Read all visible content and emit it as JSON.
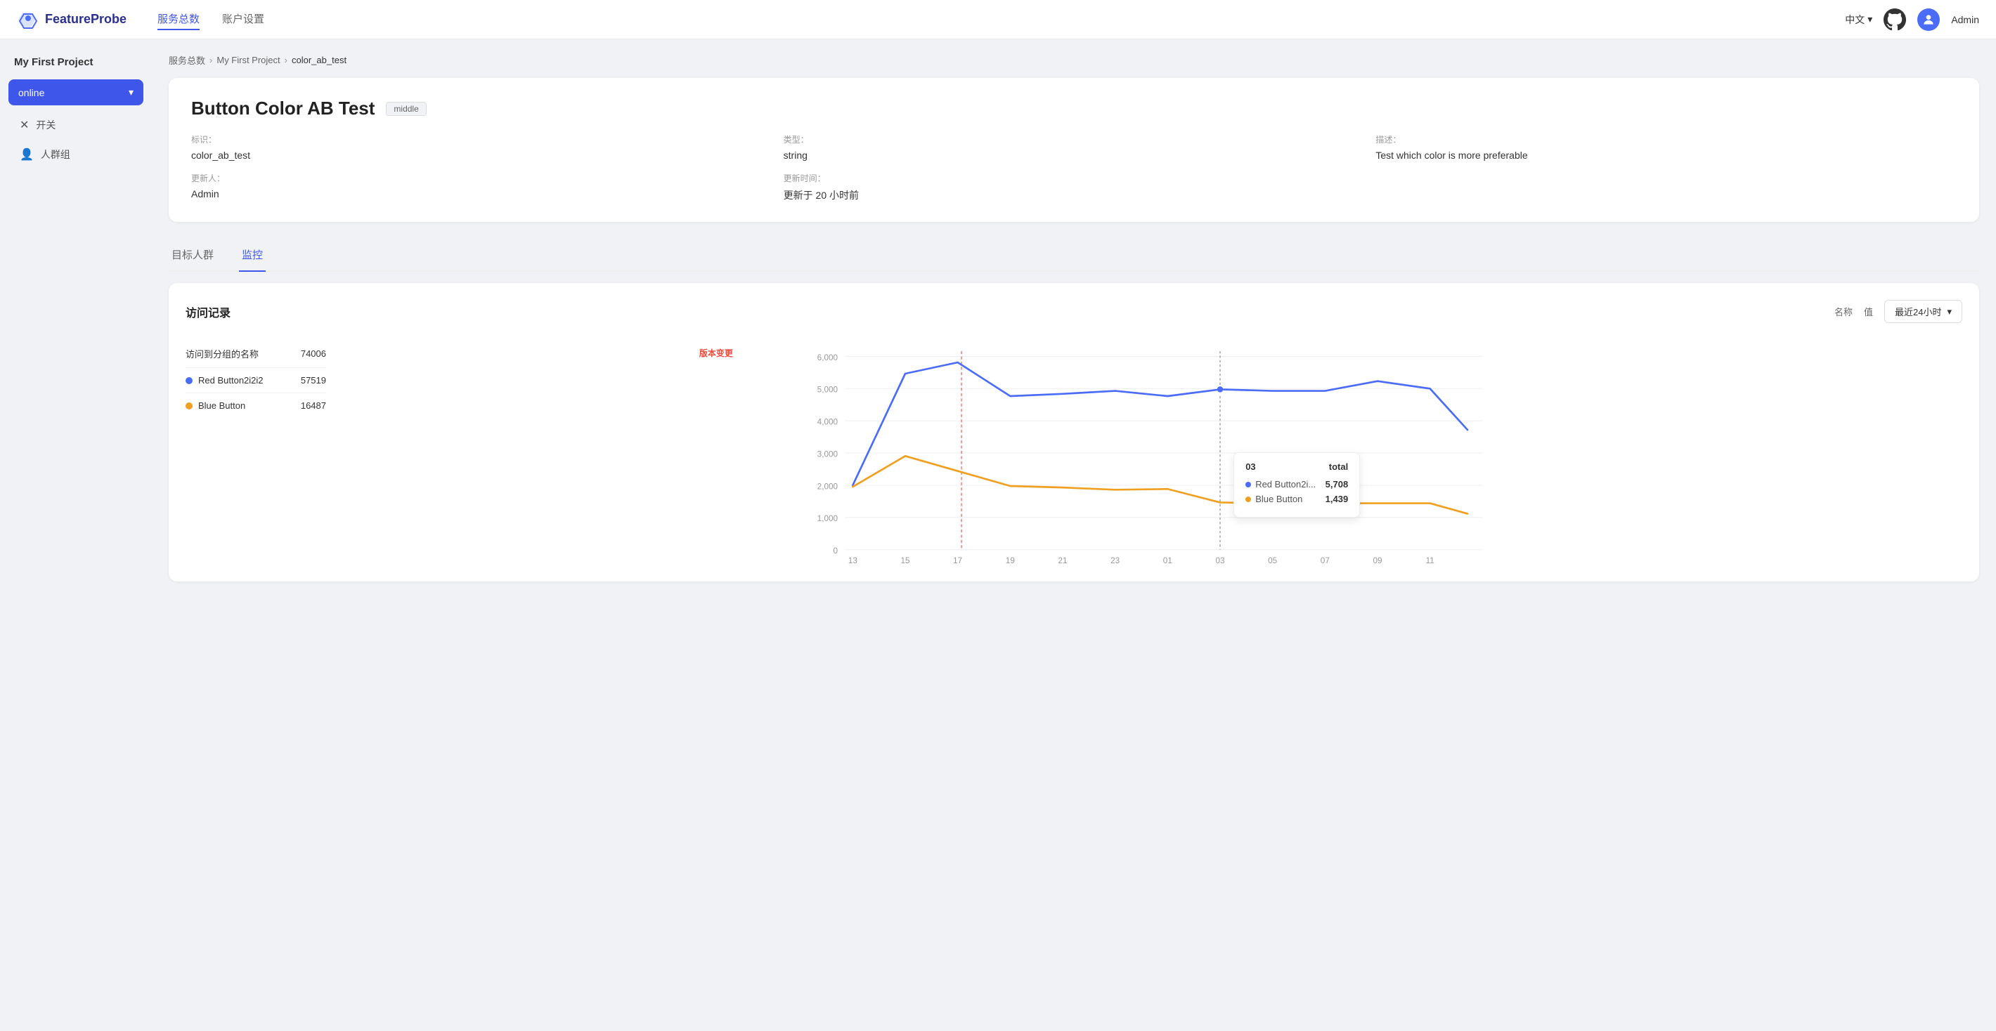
{
  "app": {
    "name": "FeatureProbe"
  },
  "topNav": {
    "links": [
      {
        "id": "services",
        "label": "服务总数",
        "active": true
      },
      {
        "id": "account",
        "label": "账户设置",
        "active": false
      }
    ],
    "language": "中文",
    "username": "Admin"
  },
  "sidebar": {
    "projectTitle": "My First Project",
    "env": {
      "label": "online",
      "chevron": "▾"
    },
    "menuItems": [
      {
        "id": "toggle",
        "icon": "✕",
        "label": "开关"
      },
      {
        "id": "segment",
        "icon": "👤",
        "label": "人群组"
      }
    ]
  },
  "breadcrumb": {
    "items": [
      {
        "label": "服务总数",
        "link": true
      },
      {
        "label": "My First Project",
        "link": true
      },
      {
        "label": "color_ab_test",
        "link": false
      }
    ]
  },
  "feature": {
    "title": "Button Color AB Test",
    "badge": "middle",
    "meta": [
      {
        "id": "key",
        "label": "标识：",
        "value": "color_ab_test"
      },
      {
        "id": "type",
        "label": "类型：",
        "value": "string"
      },
      {
        "id": "desc",
        "label": "描述：",
        "value": "Test which color is more preferable"
      },
      {
        "id": "updater",
        "label": "更新人：",
        "value": "Admin"
      },
      {
        "id": "updateTime",
        "label": "更新时间：",
        "value": "更新于 20 小时前"
      }
    ]
  },
  "tabs": [
    {
      "id": "audience",
      "label": "目标人群",
      "active": false
    },
    {
      "id": "monitor",
      "label": "监控",
      "active": true
    }
  ],
  "monitor": {
    "title": "访问记录",
    "controls": {
      "nameLabel": "名称",
      "valueLabel": "值",
      "timeRange": "最近24小时"
    },
    "legend": [
      {
        "id": "total",
        "label": "访问到分组的名称",
        "color": null,
        "value": "74006"
      },
      {
        "id": "red",
        "label": "Red Button2i2i2",
        "color": "#4a6cf7",
        "value": "57519"
      },
      {
        "id": "blue",
        "label": "Blue Button",
        "color": "#f0a020",
        "value": "16487"
      }
    ],
    "tooltip": {
      "header": "03",
      "headerRight": "total",
      "rows": [
        {
          "label": "Red Button2i...",
          "color": "#4a6cf7",
          "value": "5,708"
        },
        {
          "label": "Blue Button",
          "color": "#f0a020",
          "value": "1,439"
        }
      ]
    },
    "xAxisLabels": [
      "13",
      "15",
      "17",
      "19",
      "21",
      "23",
      "01",
      "03",
      "05",
      "07",
      "09",
      "11"
    ],
    "yAxisLabels": [
      "0",
      "1,000",
      "2,000",
      "3,000",
      "4,000",
      "5,000",
      "6,000"
    ],
    "versionChangeLabel": "版本变更"
  }
}
